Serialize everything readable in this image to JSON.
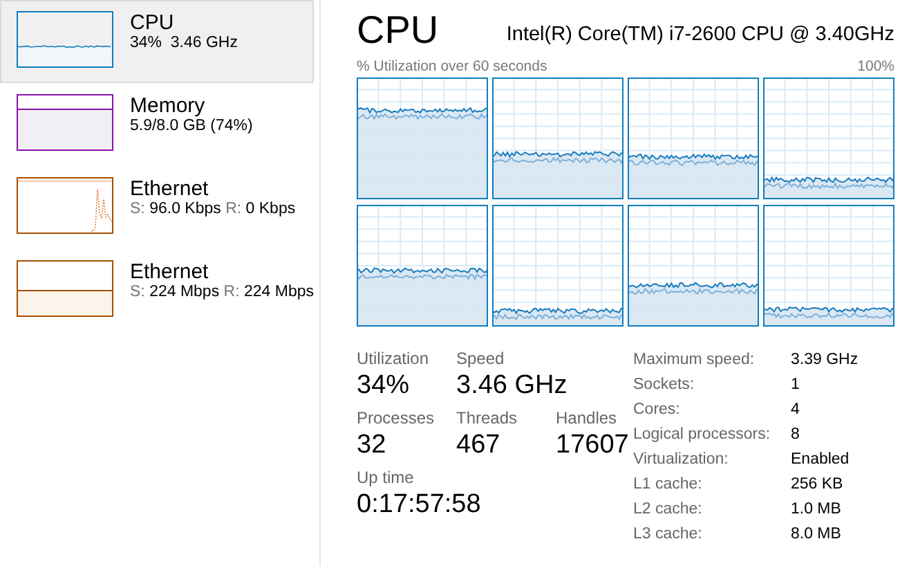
{
  "sidebar": {
    "items": [
      {
        "kind": "cpu",
        "title": "CPU",
        "color": "#117dbb",
        "selected": true,
        "detail": "34%  3.46 GHz"
      },
      {
        "kind": "memory",
        "title": "Memory",
        "color": "#8b12ae",
        "selected": false,
        "detail": "5.9/8.0 GB (74%)"
      },
      {
        "kind": "network",
        "title": "Ethernet",
        "color": "#a74f01",
        "selected": false,
        "send_label": "S:",
        "send": "96.0 Kbps",
        "receive_label": "R:",
        "receive": "0 Kbps"
      },
      {
        "kind": "network_flat",
        "title": "Ethernet",
        "color": "#a74f01",
        "selected": false,
        "send_label": "S:",
        "send": "224 Mbps",
        "receive_label": "R:",
        "receive": "224 Mbps"
      }
    ]
  },
  "header": {
    "title": "CPU",
    "model": "Intel(R) Core(TM) i7-2600 CPU @ 3.40GHz"
  },
  "graph": {
    "caption": "% Utilization over 60 seconds",
    "max_label": "100%"
  },
  "stats": [
    [
      {
        "label": "Utilization",
        "value": "34%"
      },
      {
        "label": "Speed",
        "value": "3.46 GHz"
      }
    ],
    [
      {
        "label": "Processes",
        "value": "32"
      },
      {
        "label": "Threads",
        "value": "467"
      },
      {
        "label": "Handles",
        "value": "17607"
      }
    ],
    [
      {
        "label": "Up time",
        "value": "0:17:57:58"
      }
    ]
  ],
  "specs": [
    {
      "label": "Maximum speed:",
      "value": "3.39 GHz"
    },
    {
      "label": "Sockets:",
      "value": "1"
    },
    {
      "label": "Cores:",
      "value": "4"
    },
    {
      "label": "Logical processors:",
      "value": "8"
    },
    {
      "label": "Virtualization:",
      "value": "Enabled"
    },
    {
      "label": "L1 cache:",
      "value": "256 KB"
    },
    {
      "label": "L2 cache:",
      "value": "1.0 MB"
    },
    {
      "label": "L3 cache:",
      "value": "8.0 MB"
    }
  ]
}
